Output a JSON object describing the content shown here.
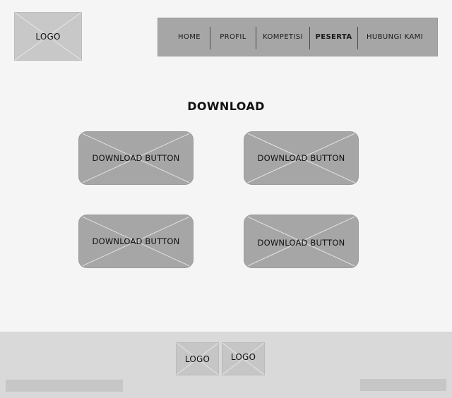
{
  "header": {
    "logo": "LOGO",
    "nav": [
      {
        "label": "HOME"
      },
      {
        "label": "PROFIL"
      },
      {
        "label": "KOMPETISI"
      },
      {
        "label": "PESERTA"
      },
      {
        "label": "HUBUNGI KAMI"
      }
    ],
    "active_nav": "PESERTA"
  },
  "main": {
    "title": "DOWNLOAD",
    "buttons": [
      {
        "label": "DOWNLOAD BUTTON"
      },
      {
        "label": "DOWNLOAD BUTTON"
      },
      {
        "label": "DOWNLOAD BUTTON"
      },
      {
        "label": "DOWNLOAD BUTTON"
      }
    ]
  },
  "footer": {
    "logos": [
      "LOGO",
      "LOGO"
    ]
  },
  "colors": {
    "background": "#f5f5f5",
    "nav_background": "#a6a6a6",
    "button_background": "#a6a6a6",
    "footer_background": "#d9d9d9",
    "placeholder_light": "#c8c8c8"
  }
}
